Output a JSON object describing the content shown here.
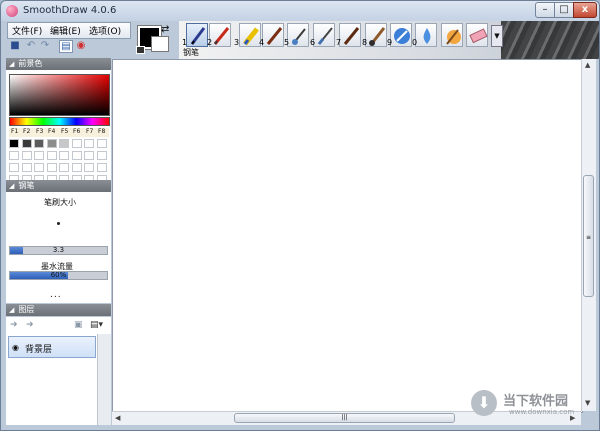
{
  "app": {
    "title": "SmoothDraw 4.0.6"
  },
  "window_controls": {
    "minimize": "–",
    "maximize": "□",
    "close": "x"
  },
  "menu": {
    "file": "文件(F)",
    "edit": "编辑(E)",
    "options": "选项(O)"
  },
  "toolbar": {
    "brushes": [
      {
        "num": "1",
        "icon": "pen-icon",
        "selected": true
      },
      {
        "num": "2",
        "icon": "pencil-icon"
      },
      {
        "num": "3",
        "icon": "highlighter-icon"
      },
      {
        "num": "4",
        "icon": "brush-icon"
      },
      {
        "num": "5",
        "icon": "airbrush-icon"
      },
      {
        "num": "6",
        "icon": "ink-pen-icon"
      },
      {
        "num": "7",
        "icon": "marker-icon"
      },
      {
        "num": "8",
        "icon": "paint-brush-icon"
      },
      {
        "num": "9",
        "icon": "star-brush-icon"
      },
      {
        "num": "0",
        "icon": "water-drop-icon"
      },
      {
        "num": "",
        "icon": "smudge-icon"
      },
      {
        "num": "",
        "icon": "eraser-icon"
      }
    ],
    "selected_label": "钢笔"
  },
  "panels": {
    "foreground": "前景色",
    "pen": "钢笔",
    "layers": "图层"
  },
  "palette": {
    "fkeys": [
      "F1",
      "F2",
      "F3",
      "F4",
      "F5",
      "F6",
      "F7",
      "F8"
    ],
    "colors": [
      "#000000",
      "#3a3a3a",
      "#5b5b5b",
      "#8c8c8c",
      "#c7c7c7",
      "#ffffff",
      "#ffffff",
      "#ffffff"
    ]
  },
  "pen": {
    "size_label": "笔刷大小",
    "size_value": "3.3",
    "size_fraction": 0.13,
    "flow_label": "墨水流量",
    "flow_value": "60%",
    "flow_fraction": 0.6,
    "more": "..."
  },
  "layers": {
    "items": [
      {
        "name": "背景层"
      }
    ]
  },
  "watermark": {
    "title": "当下软件园",
    "url": "www.downxia.com"
  }
}
